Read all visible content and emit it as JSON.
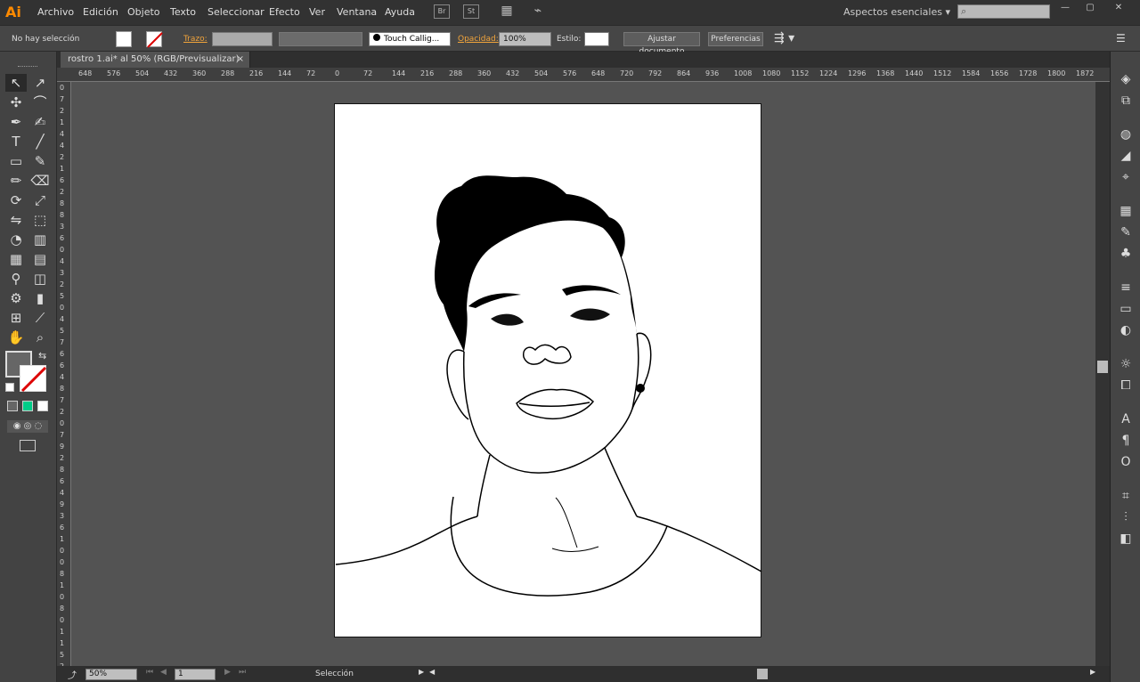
{
  "app": {
    "logo": "Ai"
  },
  "menu": [
    "Archivo",
    "Edición",
    "Objeto",
    "Texto",
    "Seleccionar",
    "Efecto",
    "Ver",
    "Ventana",
    "Ayuda"
  ],
  "menu_icons": [
    "Br",
    "St"
  ],
  "workspace": "Aspectos esenciales",
  "control": {
    "selection": "No hay selección",
    "stroke_label": "Trazo:",
    "brush": "Touch Callig...",
    "opacity_label": "Opacidad:",
    "opacity": "100%",
    "style_label": "Estilo:",
    "document_setup": "Ajustar documento",
    "preferences": "Preferencias"
  },
  "document": {
    "tab": "rostro 1.ai* al 50% (RGB/Previsualizar)",
    "close": "×"
  },
  "ruler": {
    "top": [
      "648",
      "576",
      "504",
      "432",
      "360",
      "288",
      "216",
      "144",
      "72",
      "0",
      "72",
      "144",
      "216",
      "288",
      "360",
      "432",
      "504",
      "576",
      "648",
      "720",
      "792",
      "864",
      "936",
      "1008",
      "1080",
      "1152",
      "1224",
      "1296",
      "1368",
      "1440",
      "1512",
      "1584",
      "1656",
      "1728",
      "1800",
      "1872"
    ]
  },
  "status": {
    "zoom": "50%",
    "artboard": "1",
    "tool": "Selección"
  },
  "icons": {
    "tools": [
      "selection-icon",
      "direct-selection-icon",
      "magic-wand-icon",
      "lasso-icon",
      "pen-icon",
      "curvature-icon",
      "type-icon",
      "line-icon",
      "rectangle-icon",
      "paintbrush-icon",
      "pencil-icon",
      "eraser-icon",
      "rotate-icon",
      "scale-icon",
      "width-icon",
      "free-transform-icon",
      "shape-builder-icon",
      "graph-icon",
      "mesh-icon",
      "gradient-icon",
      "eyedropper-icon",
      "blend-icon",
      "symbol-sprayer-icon",
      "column-graph-icon",
      "artboard-icon",
      "slice-icon",
      "hand-icon",
      "zoom-icon"
    ]
  }
}
